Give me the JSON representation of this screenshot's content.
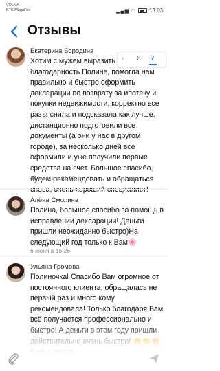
{
  "statusbar": {
    "carrier1": "VOLNA",
    "carrier2": "KTK/MegaFon",
    "icons": "signal wifi battery",
    "time": "13:03"
  },
  "appbar": {
    "title": "Отзывы",
    "back_icon": "back-arrow-icon"
  },
  "pager": {
    "prev": "‹",
    "page_6": "6",
    "page_7": "7"
  },
  "reviews": [
    {
      "author": "Екатерина Бородина",
      "text": "Хотим с мужем выразить благодарность Полине, помогла нам правильно и быстро оформить декларации по возврату за ипотеку и покупки недвижимости, корректно все разъяснила и подсказала как лучше, дистанционно подготовили все документы (а они у нас в другом городе), за несколько дней все оформили и уже получили первые средства на счет. Большое спасибо, будем рекомендовать и обращаться снова, очень хороший специалист!",
      "date": "23 марта в 11:09"
    },
    {
      "author": "Алёна Смолина",
      "text": "Полина, большое спасибо  за помощь в исправлении декларации! Деньги пришли неожиданно быстро)На следующий год только к Вам🌸",
      "date": "6 июня в 16:26"
    },
    {
      "author": "Ульяна Громова",
      "text": "Полиночка! Спасибо Вам огромное от постоянного клиента, обращалась не первый раз и много кому рекомендовала! Только благодаря Вам всё получается профессионально и быстро! А деньги в этом году пришли действительно очень быстро! 👏👏👏 Ещё хочется",
      "date": ""
    }
  ],
  "bottombar": {
    "attach_icon": "paperclip-icon",
    "send_icon": "send-icon"
  }
}
